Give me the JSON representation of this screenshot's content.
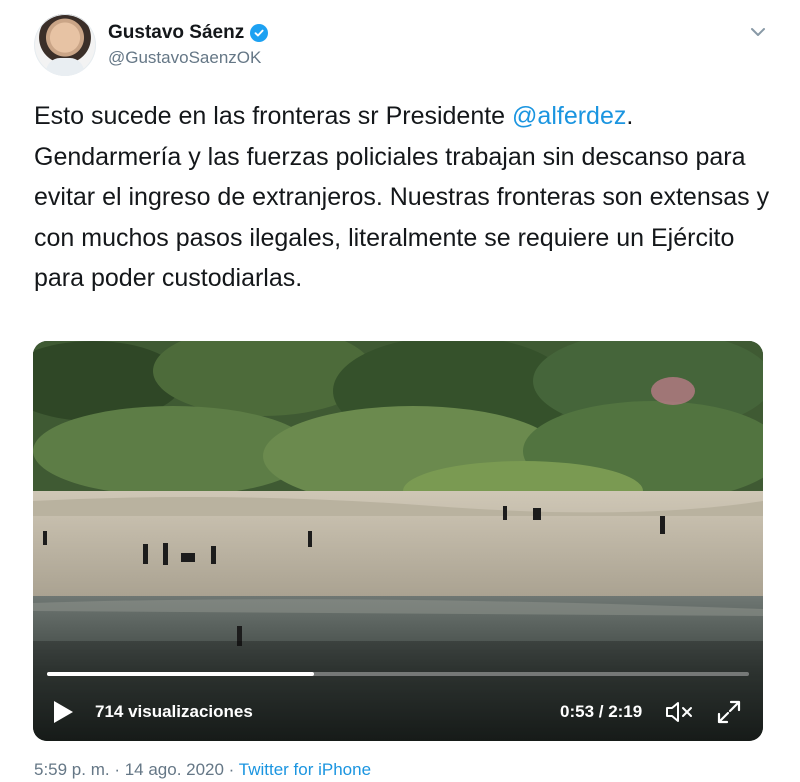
{
  "user": {
    "display_name": "Gustavo Sáenz",
    "handle": "@GustavoSaenzOK",
    "verified": true
  },
  "tweet": {
    "text_before_mention": "Esto sucede en las fronteras sr Presidente ",
    "mention": "@alferdez",
    "text_after_mention": ". Gendarmería y las fuerzas policiales trabajan sin descanso para evitar el ingreso de extranjeros. Nuestras fronteras son extensas y con muchos pasos ilegales, literalmente se requiere un Ejército para poder custodiarlas."
  },
  "video": {
    "views": "714 visualizaciones",
    "time": "0:53 / 2:19",
    "progress": 0.38
  },
  "meta": {
    "timestamp": "5:59 p. m. · 14 ago. 2020 · ",
    "source": "Twitter for iPhone"
  },
  "colors": {
    "link": "#1b95e0",
    "verified": "#1da1f2",
    "secondary_text": "#657786"
  },
  "icons": [
    "verified-badge-icon",
    "chevron-down-icon",
    "play-icon",
    "volume-muted-icon",
    "fullscreen-icon"
  ]
}
